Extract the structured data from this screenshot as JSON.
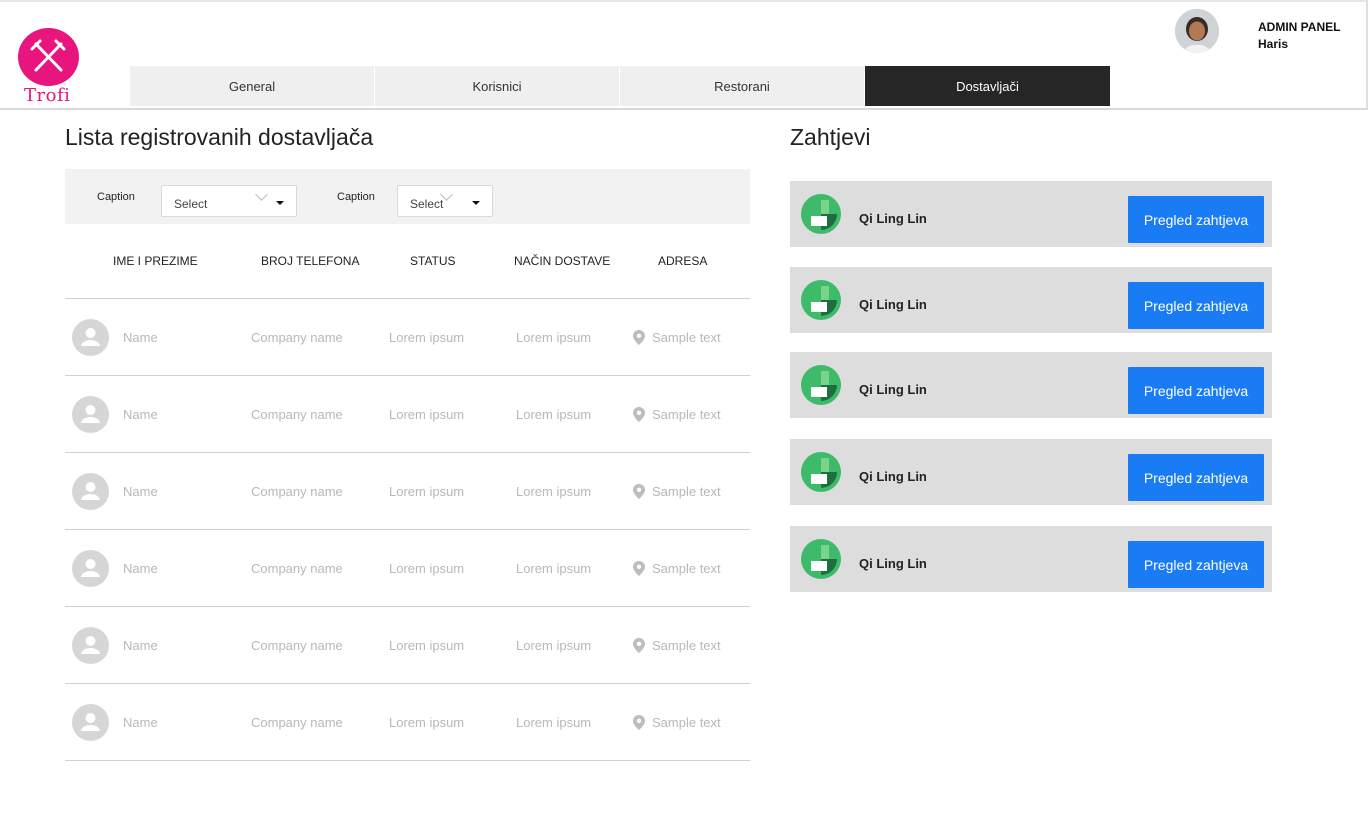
{
  "brand": {
    "name": "Trofi",
    "color": "#e8157f",
    "logo_icon": "fork-knife-icon"
  },
  "user": {
    "panel_label": "ADMIN PANEL",
    "name": "Haris"
  },
  "tabs": [
    {
      "label": "General",
      "active": false
    },
    {
      "label": "Korisnici",
      "active": false
    },
    {
      "label": "Restorani",
      "active": false
    },
    {
      "label": "Dostavljači",
      "active": true
    }
  ],
  "delivery_list": {
    "title": "Lista registrovanih dostavljača",
    "filters": [
      {
        "caption": "Caption",
        "value": "Select"
      },
      {
        "caption": "Caption",
        "value": "Select"
      }
    ],
    "columns": [
      "IME I PREZIME",
      "BROJ TELEFONA",
      "STATUS",
      "NAČIN DOSTAVE",
      "ADRESA"
    ],
    "rows": [
      {
        "name": "Name",
        "phone": "Company name",
        "status": "Lorem ipsum",
        "delivery": "Lorem ipsum",
        "address": "Sample text"
      },
      {
        "name": "Name",
        "phone": "Company name",
        "status": "Lorem ipsum",
        "delivery": "Lorem ipsum",
        "address": "Sample text"
      },
      {
        "name": "Name",
        "phone": "Company name",
        "status": "Lorem ipsum",
        "delivery": "Lorem ipsum",
        "address": "Sample text"
      },
      {
        "name": "Name",
        "phone": "Company name",
        "status": "Lorem ipsum",
        "delivery": "Lorem ipsum",
        "address": "Sample text"
      },
      {
        "name": "Name",
        "phone": "Company name",
        "status": "Lorem ipsum",
        "delivery": "Lorem ipsum",
        "address": "Sample text"
      },
      {
        "name": "Name",
        "phone": "Company name",
        "status": "Lorem ipsum",
        "delivery": "Lorem ipsum",
        "address": "Sample text"
      }
    ]
  },
  "requests": {
    "title": "Zahtjevi",
    "items": [
      {
        "name": "Qi Ling Lin",
        "button": "Pregled zahtjeva"
      },
      {
        "name": "Qi Ling Lin",
        "button": "Pregled zahtjeva"
      },
      {
        "name": "Qi Ling Lin",
        "button": "Pregled zahtjeva"
      },
      {
        "name": "Qi Ling Lin",
        "button": "Pregled zahtjeva"
      },
      {
        "name": "Qi Ling Lin",
        "button": "Pregled zahtjeva"
      }
    ],
    "button_color": "#1a7cf5"
  }
}
